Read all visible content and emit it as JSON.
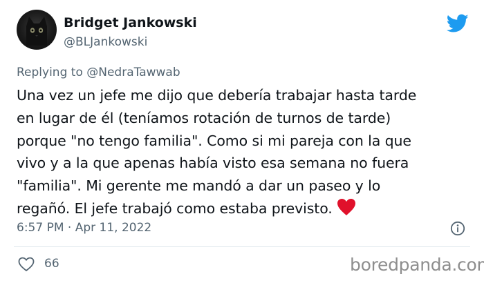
{
  "author": {
    "name": "Bridget Jankowski",
    "handle": "@BLJankowski"
  },
  "reply": {
    "prefix": "Replying to",
    "mention": "@NedraTawwab"
  },
  "tweet": {
    "text": "Una vez un jefe me dijo que debería trabajar hasta tarde\nen lugar de él (teníamos rotación de turnos de tarde)\nporque \"no tengo familia\". Como si mi pareja con la que\nvivo y a la que apenas había visto esa semana no fuera\n\"familia\". Mi gerente me mandó a dar un paseo y lo\nregañó. El jefe trabajó como estaba previsto.",
    "emoji": "red-heart",
    "time": "6:57 PM",
    "separator": "·",
    "date": "Apr 11, 2022"
  },
  "stats": {
    "likes": "66"
  },
  "watermark": "boredpanda.com",
  "colors": {
    "twitter_blue": "#1d9bf0",
    "heart_red": "#e0112b",
    "secondary_text": "#536471"
  }
}
